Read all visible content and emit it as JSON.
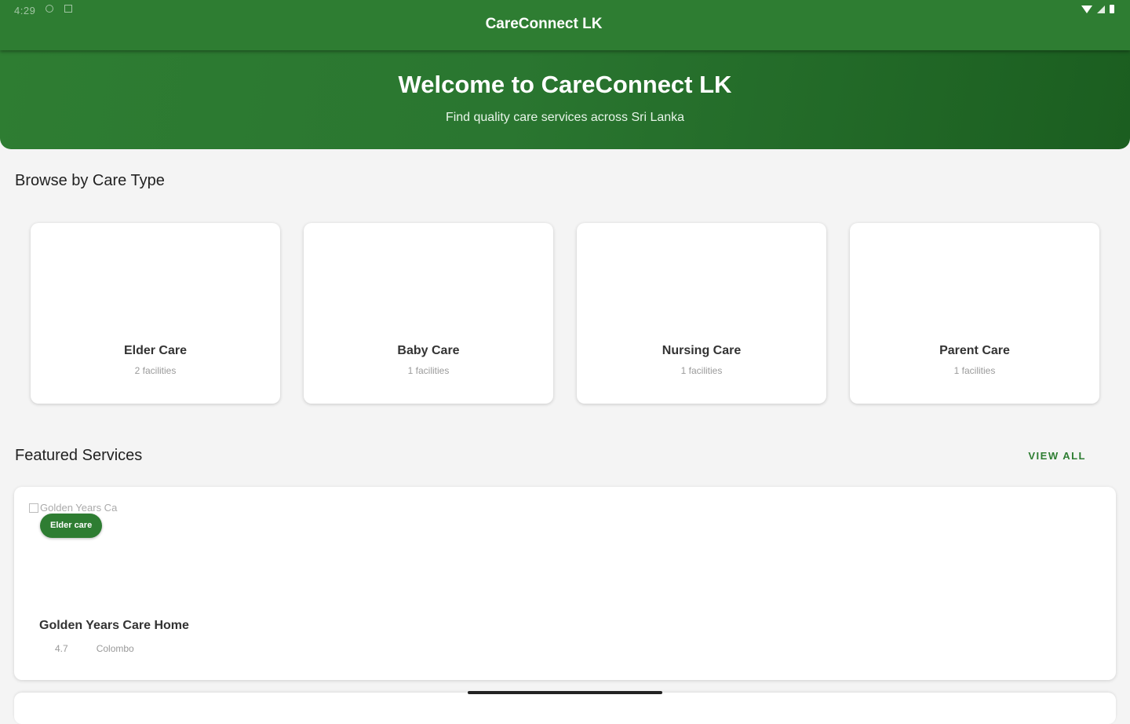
{
  "status_bar": {
    "time": "4:29"
  },
  "app_bar": {
    "title": "CareConnect LK"
  },
  "hero": {
    "title": "Welcome to CareConnect LK",
    "subtitle": "Find quality care services across Sri Lanka"
  },
  "browse": {
    "title": "Browse by Care Type",
    "types": [
      {
        "name": "Elder Care",
        "count": "2 facilities"
      },
      {
        "name": "Baby Care",
        "count": "1 facilities"
      },
      {
        "name": "Nursing Care",
        "count": "1 facilities"
      },
      {
        "name": "Parent Care",
        "count": "1 facilities"
      }
    ]
  },
  "featured": {
    "title": "Featured Services",
    "view_all": "VIEW ALL",
    "items": [
      {
        "image_alt": "Golden Years Ca",
        "badge": "Elder care",
        "name": "Golden Years Care Home",
        "rating": "4.7",
        "location": "Colombo"
      }
    ]
  },
  "colors": {
    "primary": "#2e7d32",
    "primary_dark": "#1b5e20",
    "background": "#f4f4f4"
  }
}
